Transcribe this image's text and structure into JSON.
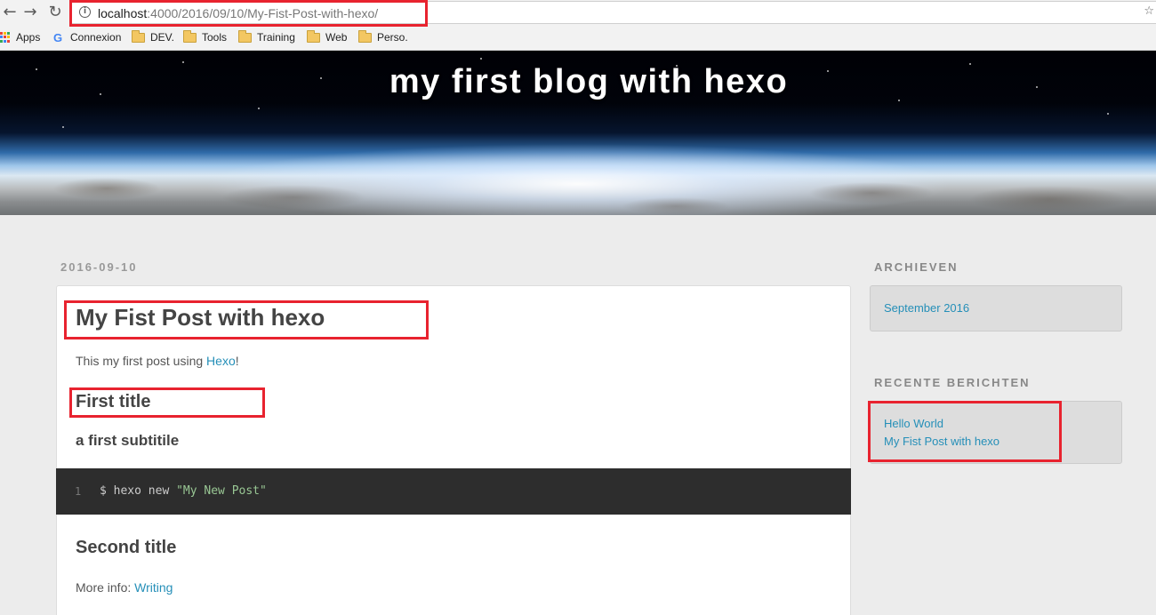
{
  "browser": {
    "url_host": "localhost",
    "url_rest": ":4000/2016/09/10/My-Fist-Post-with-hexo/",
    "nav": {
      "back_icon": "back-arrow-icon",
      "forward_icon": "forward-arrow-icon",
      "reload_icon": "reload-icon"
    },
    "bookmarks": [
      {
        "label": "Apps",
        "icon": "apps-grid-icon"
      },
      {
        "label": "Connexion",
        "icon": "google-icon"
      },
      {
        "label": "DEV.",
        "icon": "folder-icon"
      },
      {
        "label": "Tools",
        "icon": "folder-icon"
      },
      {
        "label": "Training",
        "icon": "folder-icon"
      },
      {
        "label": "Web",
        "icon": "folder-icon"
      },
      {
        "label": "Perso.",
        "icon": "folder-icon"
      }
    ]
  },
  "blog": {
    "title": "my first blog with hexo"
  },
  "post": {
    "date": "2016-09-10",
    "title": "My Fist Post with hexo",
    "intro_before": "This my first post using ",
    "intro_link": "Hexo",
    "intro_after": "!",
    "heading1": "First title",
    "subheading": "a first subtitile",
    "code": {
      "line_number": "1",
      "command": "$ hexo new ",
      "string": "\"My New Post\""
    },
    "heading2": "Second title",
    "more_before": "More info: ",
    "more_link": "Writing"
  },
  "sidebar": {
    "archives": {
      "title": "ARCHIEVEN",
      "items": [
        "September 2016"
      ]
    },
    "recent": {
      "title": "RECENTE BERICHTEN",
      "items": [
        "Hello World",
        "My Fist Post with hexo"
      ]
    }
  },
  "colors": {
    "link": "#258fb8",
    "highlight_box": "#e8232f",
    "code_bg": "#2d2d2d",
    "code_string": "#99c794"
  }
}
